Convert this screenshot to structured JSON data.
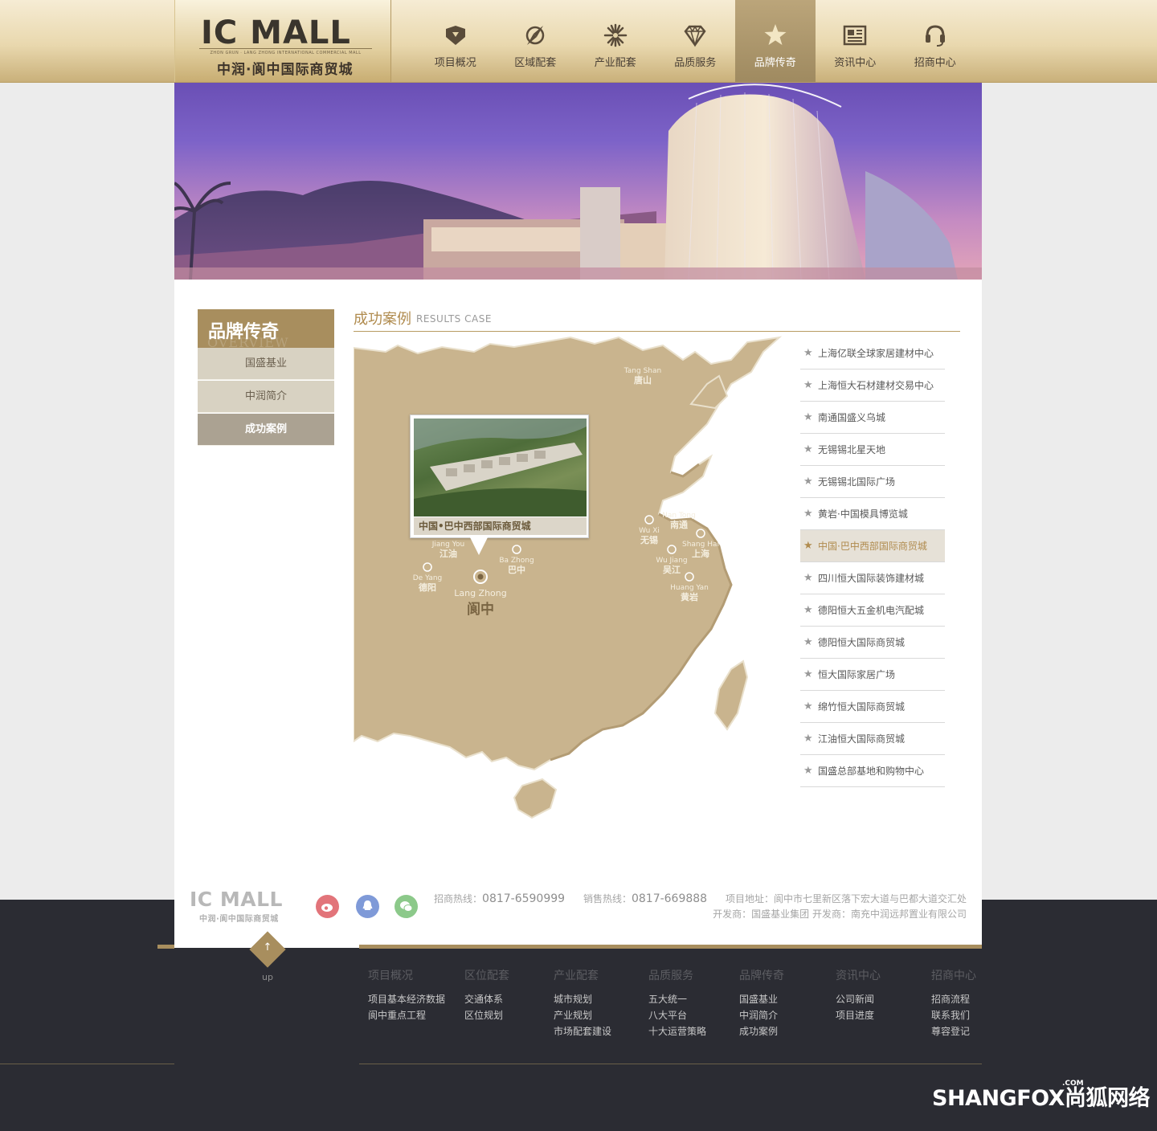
{
  "header": {
    "logo_main": "IC MALL",
    "logo_sub": "ZHON GRUN · LANG ZHONG INTERNATIONAL COMMERCIAL MALL",
    "logo_cn": "中润·阆中国际商贸城",
    "nav": [
      {
        "label": "项目概况",
        "icon": "diamond-badge-icon",
        "active": false
      },
      {
        "label": "区域配套",
        "icon": "compass-icon",
        "active": false
      },
      {
        "label": "产业配套",
        "icon": "sunburst-icon",
        "active": false
      },
      {
        "label": "品质服务",
        "icon": "gem-icon",
        "active": false
      },
      {
        "label": "品牌传奇",
        "icon": "star-icon",
        "active": true
      },
      {
        "label": "资讯中心",
        "icon": "newspaper-icon",
        "active": false
      },
      {
        "label": "招商中心",
        "icon": "headset-icon",
        "active": false
      }
    ]
  },
  "sidebar": {
    "title": "品牌传奇",
    "watermark": "OVERVIEW",
    "items": [
      {
        "label": "国盛基业",
        "active": false
      },
      {
        "label": "中润简介",
        "active": false
      },
      {
        "label": "成功案例",
        "active": true
      }
    ]
  },
  "section": {
    "title": "成功案例",
    "title_en": "RESULTS CASE"
  },
  "map": {
    "callout_caption": "中国•巴中西部国际商贸城",
    "cities": [
      {
        "en": "Tang Shan",
        "cn": "唐山"
      },
      {
        "en": "Nan Tong",
        "cn": "南通"
      },
      {
        "en": "Wu Xi",
        "cn": "无锡"
      },
      {
        "en": "Shang Hai",
        "cn": "上海"
      },
      {
        "en": "Wu Jiang",
        "cn": "吴江"
      },
      {
        "en": "Huang Yan",
        "cn": "黄岩"
      },
      {
        "en": "Jiang You",
        "cn": "江油"
      },
      {
        "en": "Ba Zhong",
        "cn": "巴中"
      },
      {
        "en": "De Yang",
        "cn": "德阳"
      },
      {
        "en": "Lang Zhong",
        "cn": "阆中"
      }
    ]
  },
  "cases": [
    {
      "label": "上海亿联全球家居建材中心",
      "active": false
    },
    {
      "label": "上海恒大石材建材交易中心",
      "active": false
    },
    {
      "label": "南通国盛义乌城",
      "active": false
    },
    {
      "label": "无锡锡北星天地",
      "active": false
    },
    {
      "label": "无锡锡北国际广场",
      "active": false
    },
    {
      "label": "黄岩·中国模具博览城",
      "active": false
    },
    {
      "label": "中国·巴中西部国际商贸城",
      "active": true
    },
    {
      "label": "四川恒大国际装饰建材城",
      "active": false
    },
    {
      "label": "德阳恒大五金机电汽配城",
      "active": false
    },
    {
      "label": "德阳恒大国际商贸城",
      "active": false
    },
    {
      "label": "恒大国际家居广场",
      "active": false
    },
    {
      "label": "绵竹恒大国际商贸城",
      "active": false
    },
    {
      "label": "江油恒大国际商贸城",
      "active": false
    },
    {
      "label": "国盛总部基地和购物中心",
      "active": false
    }
  ],
  "footer": {
    "logo": "IC MALL",
    "logo_cn": "中润·阆中国际商贸城",
    "hotline_label": "招商热线：",
    "hotline": "0817-6590999",
    "sales_label": "销售热线：",
    "sales": "0817-669888",
    "address": "项目地址：阆中市七里新区落下宏大道与巴都大道交汇处",
    "developer_line": "开发商：国盛基业集团   开发商：南充中润远邦置业有限公司",
    "up_label": "up",
    "social": [
      {
        "icon": "weibo-icon",
        "color": "#e2747a"
      },
      {
        "icon": "qq-icon",
        "color": "#7f9ad8"
      },
      {
        "icon": "wechat-icon",
        "color": "#8cc98a"
      }
    ],
    "columns": [
      {
        "heading": "项目概况",
        "links": [
          "项目基本经济数据",
          "阆中重点工程"
        ]
      },
      {
        "heading": "区位配套",
        "links": [
          "交通体系",
          "区位规划"
        ]
      },
      {
        "heading": "产业配套",
        "links": [
          "城市规划",
          "产业规划",
          "市场配套建设"
        ]
      },
      {
        "heading": "品质服务",
        "links": [
          "五大统一",
          "八大平台",
          "十大运营策略"
        ]
      },
      {
        "heading": "品牌传奇",
        "links": [
          "国盛基业",
          "中润简介",
          "成功案例"
        ]
      },
      {
        "heading": "资讯中心",
        "links": [
          "公司新闻",
          "项目进度"
        ]
      },
      {
        "heading": "招商中心",
        "links": [
          "招商流程",
          "联系我们",
          "尊容登记"
        ]
      }
    ],
    "brand": "SHANGFOX",
    "brand_cn": "尚狐网络",
    "brand_com": ".COM"
  }
}
